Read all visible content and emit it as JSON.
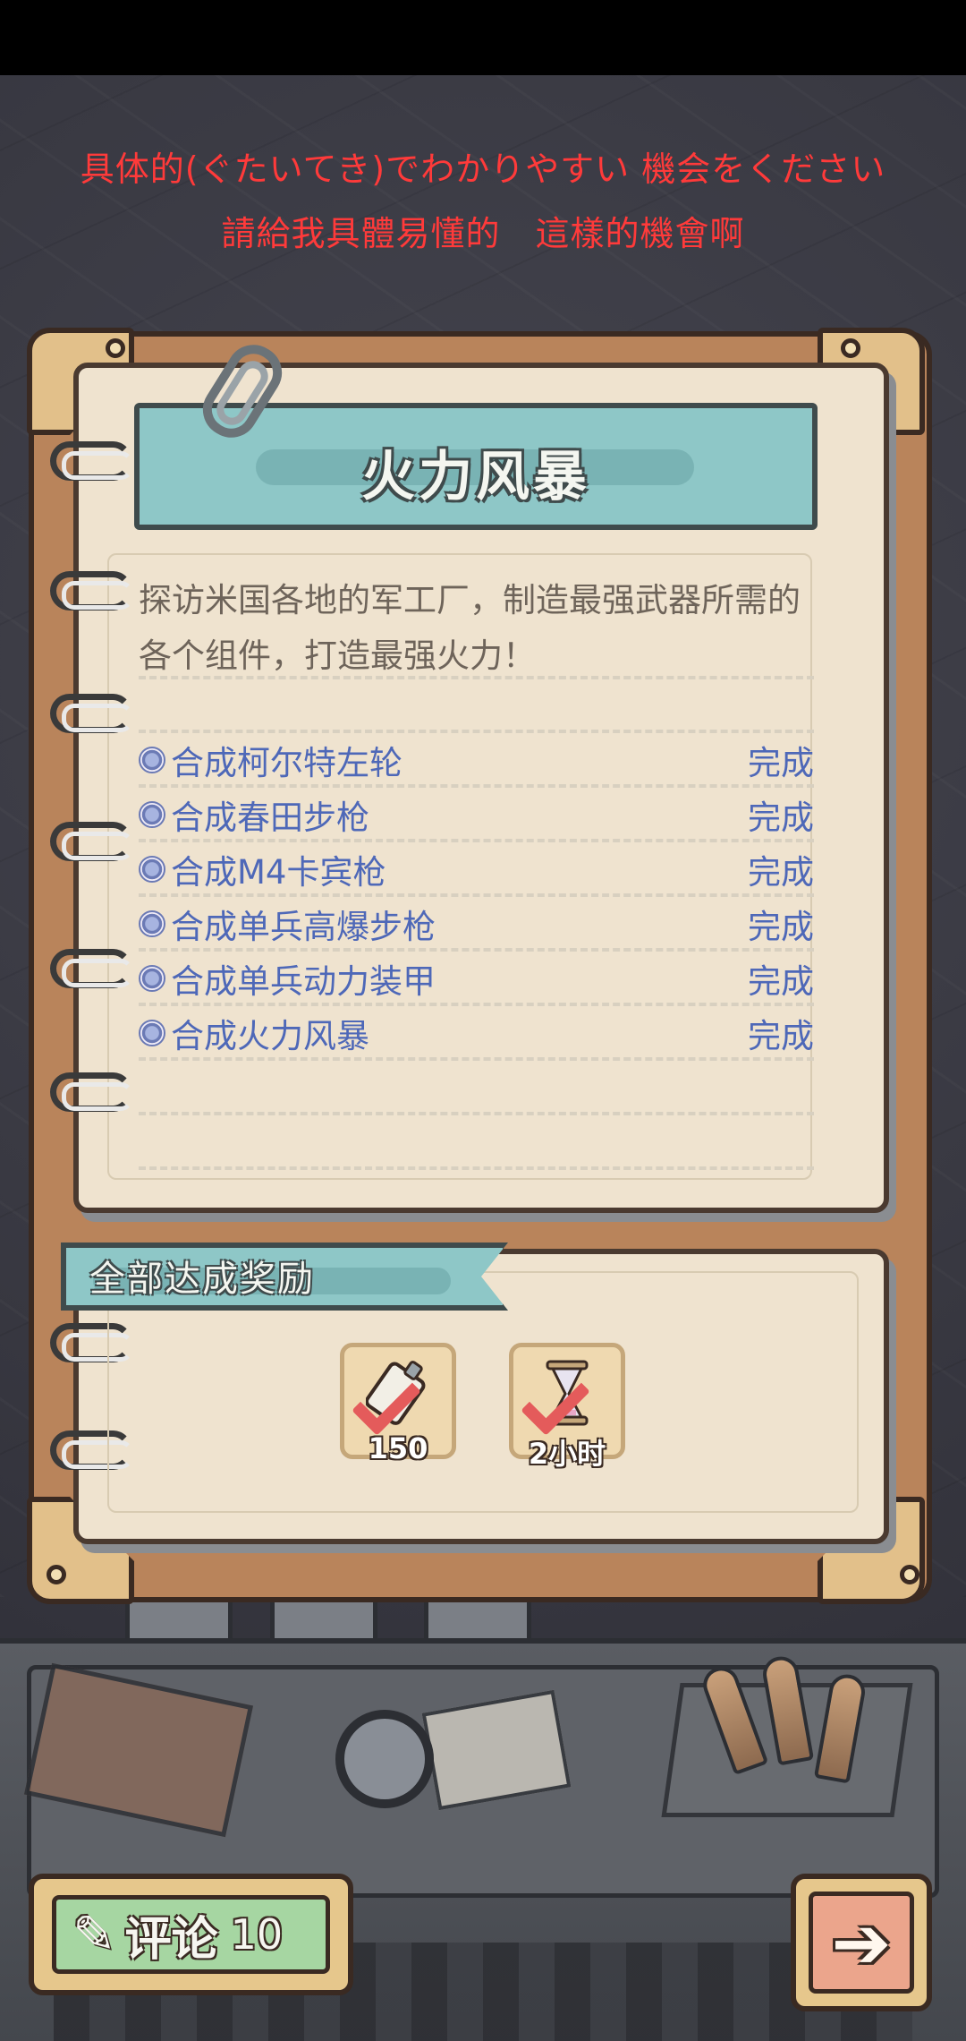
{
  "subtitles": {
    "line1": "具体的(ぐたいてき)でわかりやすい 機会をください",
    "line2": "請給我具體易懂的　這樣的機會啊"
  },
  "quest": {
    "title": "火力风暴",
    "description_line1": "探访米国各地的军工厂，制造最强武器所需的",
    "description_line2": "各个组件，打造最强火力！",
    "tasks": [
      {
        "name": "合成柯尔特左轮",
        "status": "完成"
      },
      {
        "name": "合成春田步枪",
        "status": "完成"
      },
      {
        "name": "合成M4卡宾枪",
        "status": "完成"
      },
      {
        "name": "合成单兵高爆步枪",
        "status": "完成"
      },
      {
        "name": "合成单兵动力装甲",
        "status": "完成"
      },
      {
        "name": "合成火力风暴",
        "status": "完成"
      }
    ]
  },
  "rewards": {
    "title": "全部达成奖励",
    "items": [
      {
        "icon": "glue-tube-icon",
        "count": "150"
      },
      {
        "icon": "hourglass-icon",
        "count": "2小时"
      }
    ]
  },
  "bottom_bar": {
    "comment_label": "评论",
    "comment_count": "10",
    "next_icon": "arrow-right-icon"
  },
  "colors": {
    "subtitle": "#ff3a3a",
    "task_text": "#4e68b8",
    "banner": "#8ec7c7",
    "page": "#efe3cf",
    "frame": "#b9845b"
  }
}
